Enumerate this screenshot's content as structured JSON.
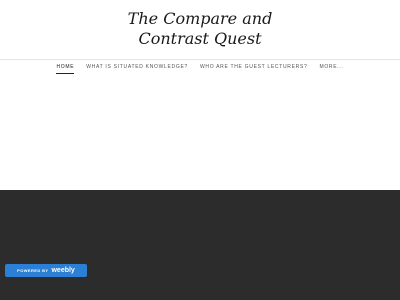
{
  "header": {
    "title_line1": "The Compare and",
    "title_line2": "Contrast Quest"
  },
  "nav": {
    "items": [
      {
        "label": "HOME",
        "active": true
      },
      {
        "label": "WHAT IS SITUATED KNOWLEDGE?",
        "active": false
      },
      {
        "label": "WHO ARE THE GUEST LECTURERS?",
        "active": false
      },
      {
        "label": "MORE...",
        "active": false
      }
    ]
  },
  "badge": {
    "powered_by": "POWERED BY",
    "brand": "weebly"
  },
  "colors": {
    "footer_background": "#2c2c2c",
    "badge_background": "#2b7fd4"
  }
}
